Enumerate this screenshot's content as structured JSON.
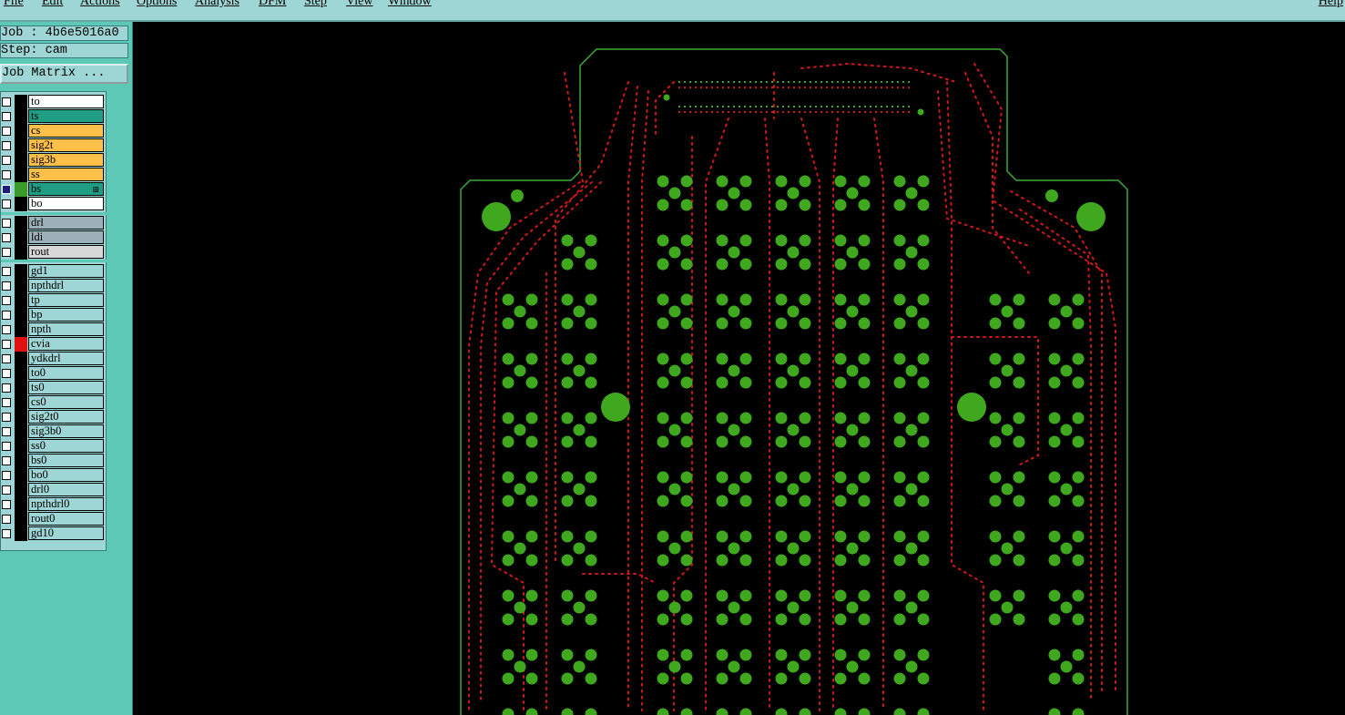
{
  "menubar": {
    "items": [
      "File",
      "Edit",
      "Actions",
      "Options",
      "Analysis",
      "DFM",
      "Step",
      "View",
      "Window"
    ],
    "right_text": "Help"
  },
  "panel": {
    "job": "Job : 4b6e5016a0",
    "step": "Step: cam",
    "job_matrix_label": "Job Matrix ..."
  },
  "layers": [
    {
      "name": "to",
      "color": "white",
      "checked": false,
      "swatch": "#000000"
    },
    {
      "name": "ts",
      "color": "teal",
      "checked": false,
      "swatch": "#000000"
    },
    {
      "name": "cs",
      "color": "orange",
      "checked": false,
      "swatch": "#000000"
    },
    {
      "name": "sig2t",
      "color": "orange",
      "checked": false,
      "swatch": "#000000"
    },
    {
      "name": "sig3b",
      "color": "orange",
      "checked": false,
      "swatch": "#000000"
    },
    {
      "name": "ss",
      "color": "orange",
      "checked": false,
      "swatch": "#000000"
    },
    {
      "name": "bs",
      "color": "teal",
      "checked": true,
      "swatch": "#3a9a2a",
      "marked": true
    },
    {
      "name": "bo",
      "color": "white",
      "checked": false,
      "swatch": "#000000"
    },
    {
      "name": "drl",
      "color": "grey",
      "checked": false,
      "swatch": "#000000"
    },
    {
      "name": "ldi",
      "color": "grey",
      "checked": false,
      "swatch": "#000000"
    },
    {
      "name": "rout",
      "color": "lightgrey",
      "checked": false,
      "swatch": "#000000"
    },
    {
      "name": "gd1",
      "color": "cyan",
      "checked": false,
      "swatch": "#000000"
    },
    {
      "name": "npthdrl",
      "color": "cyan",
      "checked": false,
      "swatch": "#000000"
    },
    {
      "name": "tp",
      "color": "cyan",
      "checked": false,
      "swatch": "#000000"
    },
    {
      "name": "bp",
      "color": "cyan",
      "checked": false,
      "swatch": "#000000"
    },
    {
      "name": "npth",
      "color": "cyan",
      "checked": false,
      "swatch": "#000000"
    },
    {
      "name": "cvia",
      "color": "cyan",
      "checked": false,
      "swatch": "#e01010"
    },
    {
      "name": "ydkdrl",
      "color": "cyan",
      "checked": false,
      "swatch": "#000000"
    },
    {
      "name": "to0",
      "color": "cyan",
      "checked": false,
      "swatch": "#000000"
    },
    {
      "name": "ts0",
      "color": "cyan",
      "checked": false,
      "swatch": "#000000"
    },
    {
      "name": "cs0",
      "color": "cyan",
      "checked": false,
      "swatch": "#000000"
    },
    {
      "name": "sig2t0",
      "color": "cyan",
      "checked": false,
      "swatch": "#000000"
    },
    {
      "name": "sig3b0",
      "color": "cyan",
      "checked": false,
      "swatch": "#000000"
    },
    {
      "name": "ss0",
      "color": "cyan",
      "checked": false,
      "swatch": "#000000"
    },
    {
      "name": "bs0",
      "color": "cyan",
      "checked": false,
      "swatch": "#000000"
    },
    {
      "name": "bo0",
      "color": "cyan",
      "checked": false,
      "swatch": "#000000"
    },
    {
      "name": "drl0",
      "color": "cyan",
      "checked": false,
      "swatch": "#000000"
    },
    {
      "name": "npthdrl0",
      "color": "cyan",
      "checked": false,
      "swatch": "#000000"
    },
    {
      "name": "rout0",
      "color": "cyan",
      "checked": false,
      "swatch": "#000000"
    },
    {
      "name": "gd10",
      "color": "cyan",
      "checked": false,
      "swatch": "#000000"
    }
  ],
  "colors": {
    "board_outline": "#3aa83a",
    "pad": "#3fa81e",
    "via": "#d01818",
    "panel_bg": "#5ec8b6",
    "menubar_bg": "#9ed6d6"
  }
}
